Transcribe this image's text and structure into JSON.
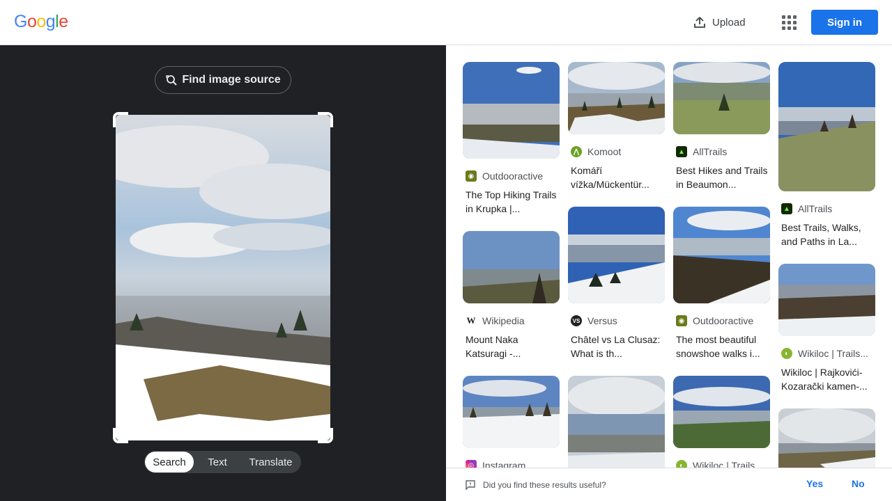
{
  "header": {
    "logo": [
      "G",
      "o",
      "o",
      "g",
      "l",
      "e"
    ],
    "upload_label": "Upload",
    "signin_label": "Sign in",
    "colors": {
      "accent": "#1a73e8",
      "logo": [
        "#4285f4",
        "#ea4335",
        "#fbbc05",
        "#4285f4",
        "#34a853",
        "#ea4335"
      ]
    }
  },
  "query_panel": {
    "find_source_label": "Find image source",
    "modes": [
      "Search",
      "Text",
      "Translate"
    ],
    "active_mode": "Search"
  },
  "results": {
    "columns": [
      [
        {
          "source": "Outdooractive",
          "title": "The Top Hiking Trails in Krupka |...",
          "icon": "outdooractive-icon",
          "icon_color": "#6b7a1a"
        },
        {
          "source": "Wikipedia",
          "title": "Mount Naka Katsuragi -...",
          "icon": "wikipedia-icon",
          "icon_color": "#ffffff"
        },
        {
          "source": "Instagram",
          "title": "",
          "icon": "instagram-icon",
          "icon_color": "#d6249f"
        }
      ],
      [
        {
          "source": "Komoot",
          "title": "Komáří vížka/Mückentür...",
          "icon": "komoot-icon",
          "icon_color": "#6aa127"
        },
        {
          "source": "Versus",
          "title": "Châtel vs La Clusaz: What is th...",
          "icon": "versus-icon",
          "icon_color": "#202124"
        },
        {
          "source": "",
          "title": "",
          "icon": "",
          "icon_color": ""
        }
      ],
      [
        {
          "source": "AllTrails",
          "title": "Best Hikes and Trails in Beaumon...",
          "icon": "alltrails-icon",
          "icon_color": "#142800"
        },
        {
          "source": "Outdooractive",
          "title": "The most beautiful snowshoe walks i...",
          "icon": "outdooractive-icon",
          "icon_color": "#6b7a1a"
        },
        {
          "source": "Wikiloc | Trails...",
          "title": "",
          "icon": "wikiloc-icon",
          "icon_color": "#87b530"
        }
      ],
      [
        {
          "source": "AllTrails",
          "title": "Best Trails, Walks, and Paths in La...",
          "icon": "alltrails-icon",
          "icon_color": "#142800"
        },
        {
          "source": "Wikiloc | Trails...",
          "title": "Wikiloc | Rajkovići-Kozarački kamen-...",
          "icon": "wikiloc-icon",
          "icon_color": "#87b530"
        },
        {
          "source": "",
          "title": "",
          "icon": "",
          "icon_color": ""
        }
      ]
    ]
  },
  "feedback": {
    "question": "Did you find these results useful?",
    "yes_label": "Yes",
    "no_label": "No"
  }
}
